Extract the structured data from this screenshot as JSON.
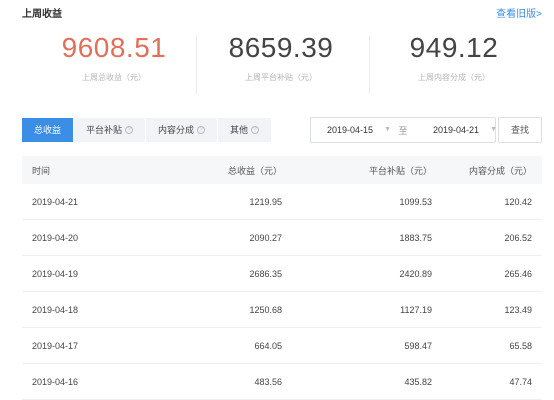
{
  "header": {
    "title": "上周收益",
    "history_link": "查看旧版>"
  },
  "stats": [
    {
      "value": "9608.51",
      "label": "上周总收益（元）"
    },
    {
      "value": "8659.39",
      "label": "上周平台补贴（元）"
    },
    {
      "value": "949.12",
      "label": "上周内容分成（元）"
    }
  ],
  "tabs": [
    {
      "label": "总收益",
      "active": true
    },
    {
      "label": "平台补贴",
      "help": "?"
    },
    {
      "label": "内容分成",
      "help": "?"
    },
    {
      "label": "其他",
      "help": "?"
    }
  ],
  "filter": {
    "start": "2019-04-15",
    "separator": "至",
    "end": "2019-04-21",
    "search": "查找"
  },
  "table": {
    "headers": [
      "时间",
      "总收益（元）",
      "平台补贴（元）",
      "内容分成（元）"
    ],
    "rows": [
      [
        "2019-04-21",
        "1219.95",
        "1099.53",
        "120.42"
      ],
      [
        "2019-04-20",
        "2090.27",
        "1883.75",
        "206.52"
      ],
      [
        "2019-04-19",
        "2686.35",
        "2420.89",
        "265.46"
      ],
      [
        "2019-04-18",
        "1250.68",
        "1127.19",
        "123.49"
      ],
      [
        "2019-04-17",
        "664.05",
        "598.47",
        "65.58"
      ],
      [
        "2019-04-16",
        "483.56",
        "435.82",
        "47.74"
      ]
    ]
  },
  "colors": {
    "accent": "#3a8ee6",
    "highlight": "#e0705a"
  }
}
